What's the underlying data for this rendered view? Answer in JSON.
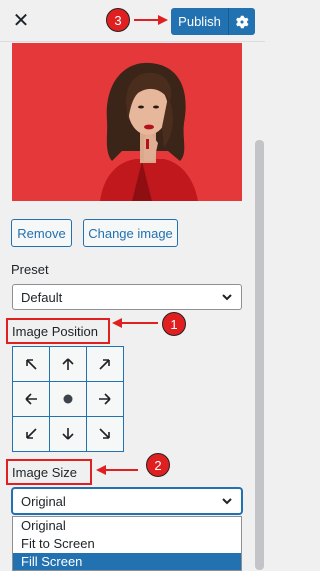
{
  "header": {
    "publish_label": "Publish",
    "close_icon": "close-icon",
    "settings_icon": "gear-icon"
  },
  "image_actions": {
    "remove_label": "Remove",
    "change_label": "Change image"
  },
  "preset": {
    "label": "Preset",
    "value": "Default"
  },
  "image_position": {
    "label": "Image Position",
    "grid": [
      "arrow-up-left-icon",
      "arrow-up-icon",
      "arrow-up-right-icon",
      "arrow-left-icon",
      "center-dot-icon",
      "arrow-right-icon",
      "arrow-down-left-icon",
      "arrow-down-icon",
      "arrow-down-right-icon"
    ]
  },
  "image_size": {
    "label": "Image Size",
    "value": "Original",
    "options": [
      "Original",
      "Fit to Screen",
      "Fill Screen"
    ],
    "highlighted_option": "Fill Screen"
  },
  "annotations": {
    "badge_1": "1",
    "badge_2": "2",
    "badge_3": "3"
  },
  "colors": {
    "accent": "#2271b1",
    "annotation_red": "#e02020",
    "preview_bg": "#e5383b"
  }
}
